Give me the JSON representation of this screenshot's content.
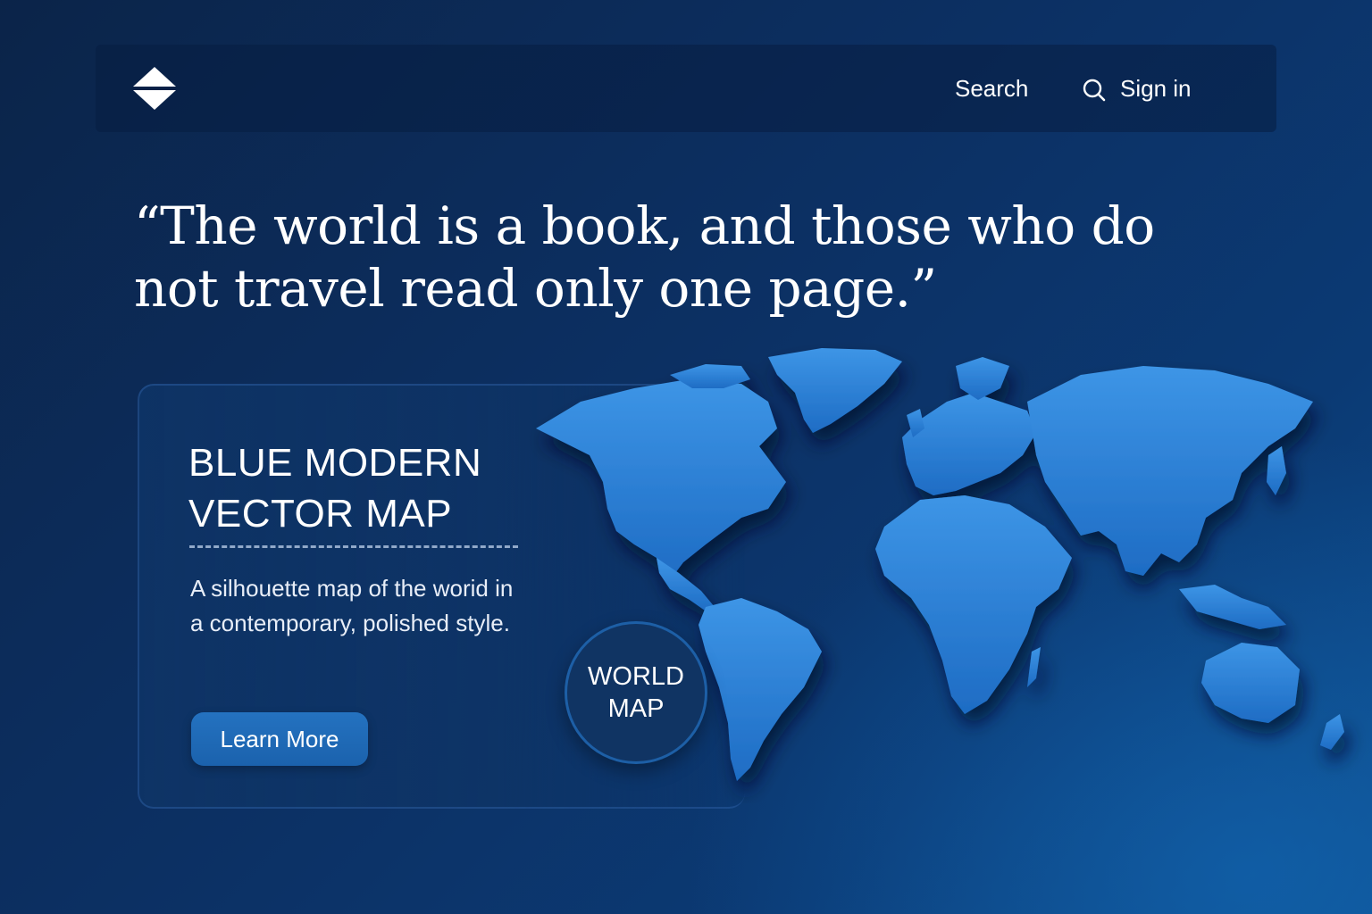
{
  "header": {
    "logo_icon": "diamond-logo-icon",
    "nav": {
      "search_label": "Search",
      "search_icon": "search-icon",
      "signin_label": "Sign in"
    }
  },
  "hero": {
    "quote": "“The world is a book, and those who do not travel read only one page.”"
  },
  "card": {
    "title": "BLUE MODERN VECTOR MAP",
    "description": "A silhouette map of the worid in a contemporary, polished style.",
    "button_label": "Learn More"
  },
  "badge": {
    "line1": "WORLD",
    "line2": "MAP"
  },
  "colors": {
    "background": "#0c3063",
    "accent": "#2472c0",
    "map": "#2a7fd6"
  }
}
